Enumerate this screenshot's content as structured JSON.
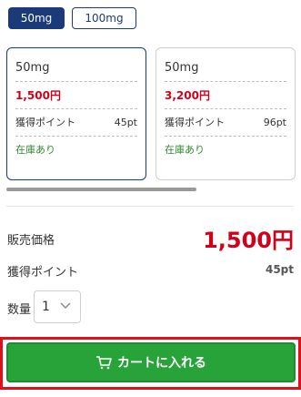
{
  "variants": {
    "tabs": [
      "50mg",
      "100mg"
    ],
    "selected_tab": "50mg"
  },
  "cards": [
    {
      "size": "50mg",
      "price": "1,500円",
      "point_label": "獲得ポイント",
      "points": "45pt",
      "stock": "在庫あり",
      "selected": true
    },
    {
      "size": "50mg",
      "price": "3,200円",
      "point_label": "獲得ポイント",
      "points": "96pt",
      "stock": "在庫あり",
      "selected": false
    }
  ],
  "summary": {
    "sale_label": "販売価格",
    "sale_price": "1,500円",
    "point_label": "獲得ポイント",
    "points": "45pt"
  },
  "quantity": {
    "label": "数量",
    "value": "1"
  },
  "cart_button": {
    "label": "カートに入れる",
    "icon": "cart-icon"
  },
  "colors": {
    "brand": "#1b3a7a",
    "price": "#d0021b",
    "stock": "#2e8b2e",
    "cta": "#27a33a",
    "highlight": "#e0101a"
  }
}
